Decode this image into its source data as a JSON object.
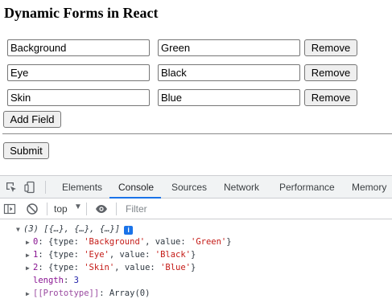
{
  "page": {
    "title": "Dynamic Forms in React",
    "rows": [
      {
        "name": "Background",
        "value": "Green",
        "remove_label": "Remove"
      },
      {
        "name": "Eye",
        "value": "Black",
        "remove_label": "Remove"
      },
      {
        "name": "Skin",
        "value": "Blue",
        "remove_label": "Remove"
      }
    ],
    "add_field_label": "Add Field",
    "submit_label": "Submit"
  },
  "devtools": {
    "tabs": [
      "Elements",
      "Console",
      "Sources",
      "Network",
      "Performance",
      "Memory"
    ],
    "active_tab": "Console",
    "context": "top",
    "filter_placeholder": "Filter",
    "accent": "#1a73e8",
    "console": {
      "summary": "(3) [{…}, {…}, {…}]",
      "badge": "i",
      "items": [
        {
          "index": "0",
          "type": "'Background'",
          "value": "'Green'"
        },
        {
          "index": "1",
          "type": "'Eye'",
          "value": "'Black'"
        },
        {
          "index": "2",
          "type": "'Skin'",
          "value": "'Blue'"
        }
      ],
      "length_key": "length",
      "length_value": "3",
      "prototype_key": "[[Prototype]]",
      "prototype_value": "Array(0)"
    }
  }
}
